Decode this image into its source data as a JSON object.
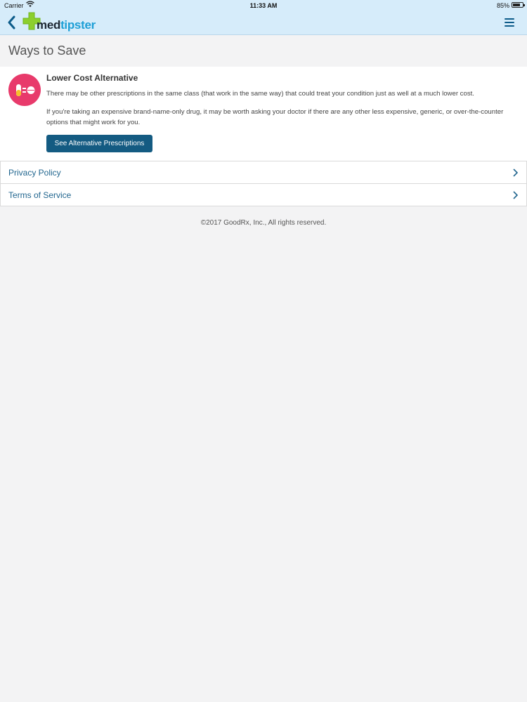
{
  "status_bar": {
    "carrier": "Carrier",
    "time": "11:33 AM",
    "battery_percent": "85%"
  },
  "nav": {
    "logo_med": "med",
    "logo_tipster": "tipster",
    "back_icon": "chevron-left-icon",
    "menu_icon": "hamburger-menu-icon"
  },
  "page": {
    "title": "Ways to Save"
  },
  "saving_card": {
    "icon": "pill-equals-tablet-icon",
    "heading": "Lower Cost Alternative",
    "paragraph1": "There may be other prescriptions in the same class (that work in the same way) that could treat your condition just as well at a much lower cost.",
    "paragraph2": "If you're taking an expensive brand-name-only drug, it may be worth asking your doctor if there are any other less expensive, generic, or over-the-counter options that might work for you.",
    "button_label": "See Alternative Prescriptions"
  },
  "links": [
    {
      "label": "Privacy Policy"
    },
    {
      "label": "Terms of Service"
    }
  ],
  "footer": {
    "copyright": "©2017 GoodRx, Inc., All rights reserved."
  },
  "colors": {
    "header_bg": "#d6ecfa",
    "accent_blue": "#145b82",
    "link_blue": "#22668f",
    "icon_pink": "#e83a6b",
    "logo_green": "#8ccf2e"
  }
}
